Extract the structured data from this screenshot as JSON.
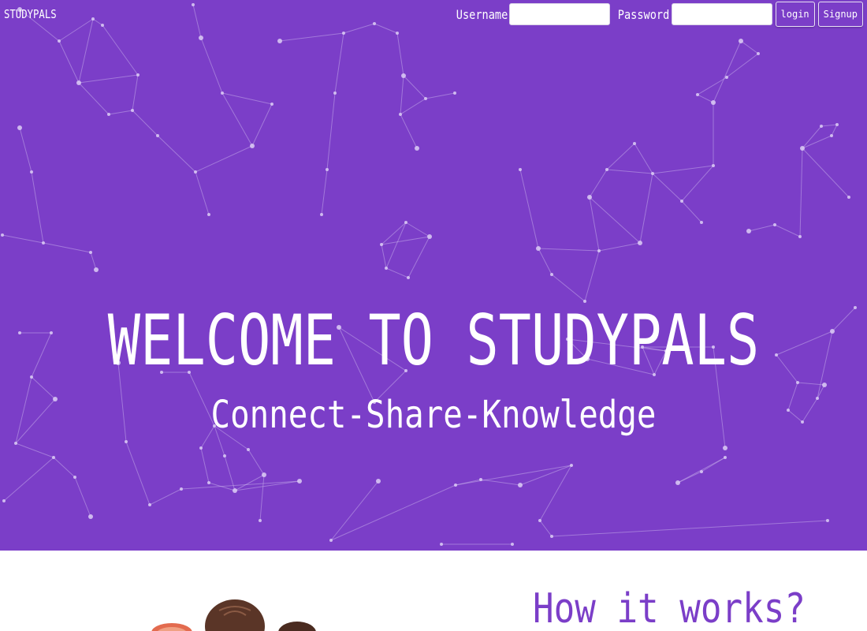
{
  "header": {
    "brand": "STUDYPALS",
    "username_label": "Username",
    "password_label": "Password",
    "username_value": "",
    "password_value": "",
    "login_label": "login",
    "signup_label": "Signup"
  },
  "hero": {
    "title": "WELCOME TO STUDYPALS",
    "subtitle": "Connect-Share-Knowledge",
    "background_color": "#7b3ec8"
  },
  "how_it_works": {
    "title": "How it works?"
  },
  "colors": {
    "accent": "#7b3ec8",
    "text_light": "#ffffff"
  }
}
